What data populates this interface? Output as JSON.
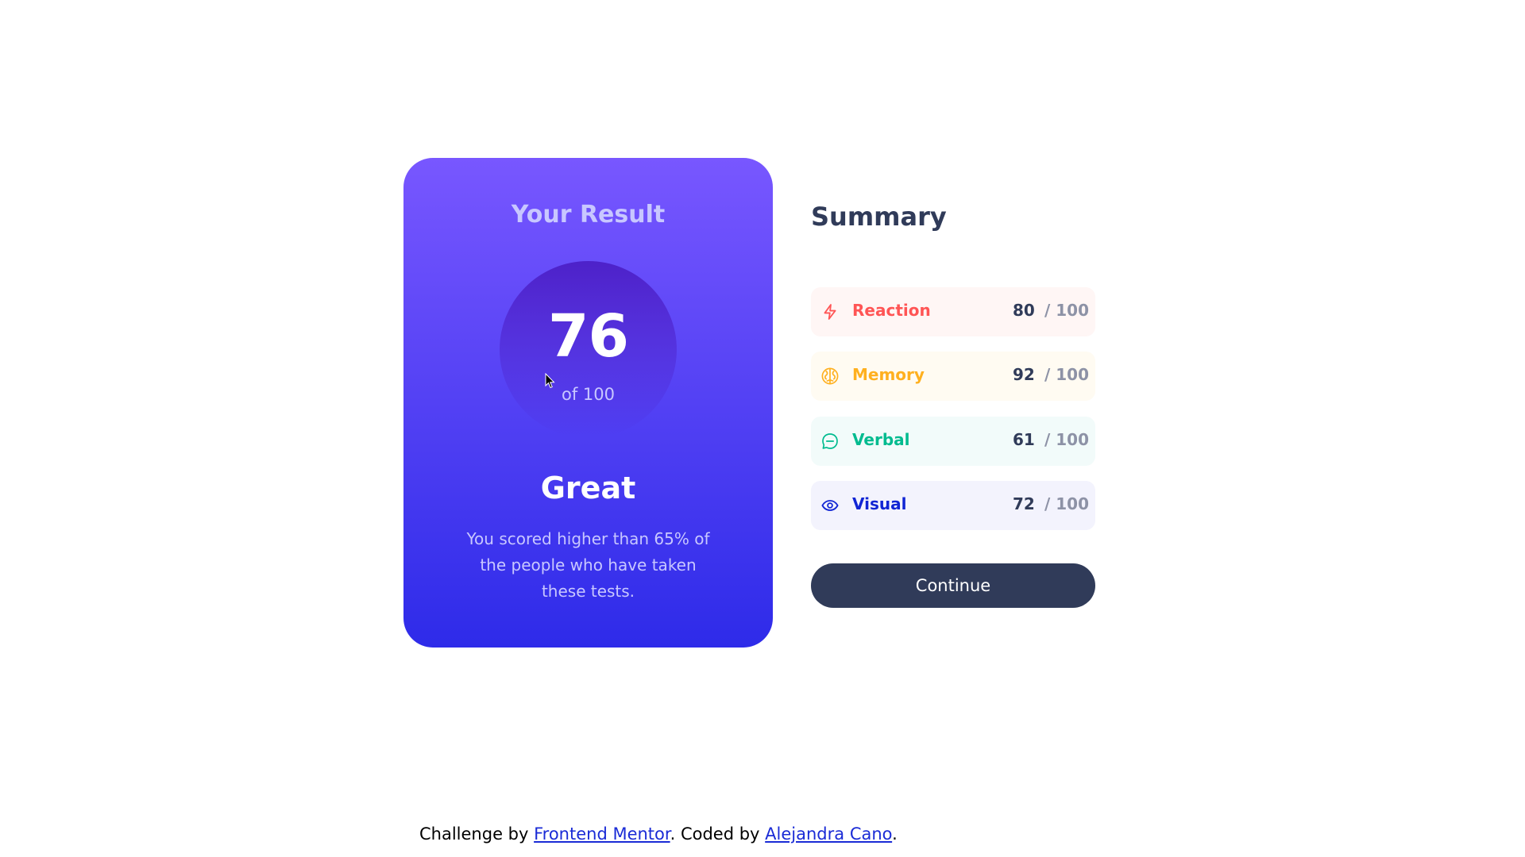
{
  "result": {
    "title": "Your Result",
    "score": "76",
    "of_label": "of 100",
    "rating": "Great",
    "message": "You scored higher than 65% of the people who have taken these tests."
  },
  "summary": {
    "title": "Summary",
    "items": [
      {
        "label": "Reaction",
        "score": "80",
        "outof": "/ 100",
        "icon": "lightning-icon",
        "color": "#ff5555",
        "bg": "#fff6f5"
      },
      {
        "label": "Memory",
        "score": "92",
        "outof": "/ 100",
        "icon": "brain-icon",
        "color": "#ffb01f",
        "bg": "#fffbf2"
      },
      {
        "label": "Verbal",
        "score": "61",
        "outof": "/ 100",
        "icon": "speech-bubble-icon",
        "color": "#00bb8f",
        "bg": "#f2fbfa"
      },
      {
        "label": "Visual",
        "score": "72",
        "outof": "/ 100",
        "icon": "eye-icon",
        "color": "#1125d4",
        "bg": "#f3f3fd"
      }
    ],
    "continue_label": "Continue"
  },
  "footer": {
    "prefix": "Challenge by ",
    "link1": "Frontend Mentor",
    "middle": ". Coded by ",
    "link2": "Alejandra Cano",
    "suffix": "."
  }
}
